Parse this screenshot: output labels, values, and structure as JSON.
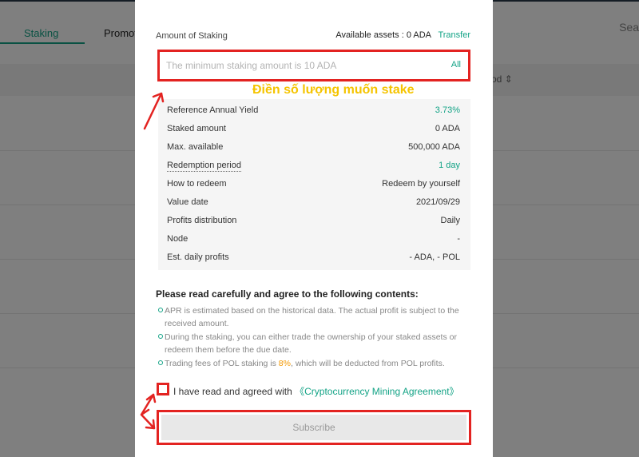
{
  "background": {
    "tabs": [
      {
        "label": "Staking",
        "active": true
      },
      {
        "label": "Promot",
        "active": false
      }
    ],
    "search_partial": "Sea",
    "column_header_partial": "od"
  },
  "modal": {
    "amount_label": "Amount of Staking",
    "available_assets_label": "Available assets :",
    "available_assets_value": "0 ADA",
    "transfer_label": "Transfer",
    "amount_placeholder": "The minimum staking amount is 10 ADA",
    "all_label": "All",
    "info_rows": [
      {
        "label": "Reference Annual Yield",
        "value": "3.73%",
        "value_color": "green"
      },
      {
        "label": "Staked amount",
        "value": "0 ADA"
      },
      {
        "label": "Max. available",
        "value": "500,000 ADA"
      },
      {
        "label": "Redemption period",
        "value": "1 day",
        "value_color": "green",
        "label_dotted": true
      },
      {
        "label": "How to redeem",
        "value": "Redeem by yourself"
      },
      {
        "label": "Value date",
        "value": "2021/09/29"
      },
      {
        "label": "Profits distribution",
        "value": "Daily"
      },
      {
        "label": "Node",
        "value": "-"
      },
      {
        "label": "Est. daily profits",
        "value": "- ADA, - POL"
      }
    ],
    "agree_title": "Please read carefully and agree to the following contents:",
    "notices": [
      {
        "text": "APR is estimated based on the historical data. The actual profit is subject to the received amount."
      },
      {
        "text": "During the staking, you can either trade the ownership of your staked assets or redeem them before the due date."
      },
      {
        "text_before": "Trading fees of POL staking is ",
        "highlight": "8%",
        "text_after": ", which will be deducted from POL profits."
      }
    ],
    "agreement_prefix": "I have read and agreed with ",
    "agreement_link": "《Cryptocurrency Mining Agreement》",
    "subscribe_label": "Subscribe"
  },
  "annotation": {
    "text": "Điền số lượng muốn stake",
    "color": "#f5c400",
    "box_color": "#e32321"
  },
  "colors": {
    "accent": "#13a386",
    "orange": "#f39800",
    "annotation_red": "#e32321"
  }
}
